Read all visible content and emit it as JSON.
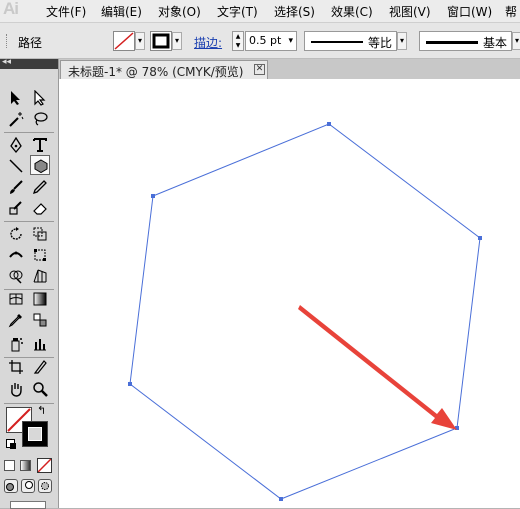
{
  "app": {
    "logo": "Ai"
  },
  "menu": [
    "文件(F)",
    "编辑(E)",
    "对象(O)",
    "文字(T)",
    "选择(S)",
    "效果(C)",
    "视图(V)",
    "窗口(W)",
    "帮"
  ],
  "control_bar": {
    "selection_type": "路径",
    "stroke_label": "描边:",
    "stroke_weight": "0.5 pt",
    "variable_width_profile": "等比",
    "brush_definition": "基本"
  },
  "document": {
    "tab_title": "未标题-1* @ 78% (CMYK/预览)",
    "tab_close": "✕"
  },
  "toolbox": {
    "collapse": "◂◂",
    "tools": [
      "selection",
      "direct-selection",
      "magic-wand",
      "lasso",
      "pen",
      "type",
      "line-segment",
      "polygon",
      "paintbrush",
      "pencil",
      "blob-brush",
      "eraser",
      "rotate",
      "scale",
      "width",
      "free-transform",
      "shape-builder",
      "perspective-grid",
      "mesh",
      "gradient",
      "eyedropper",
      "blend",
      "symbol-sprayer",
      "column-graph",
      "artboard",
      "slice",
      "hand",
      "zoom"
    ],
    "active_tool": "polygon",
    "fill": "none",
    "stroke_color": "#000000"
  },
  "colors": {
    "path_stroke": "#4a6fd8",
    "arrow": "#e8433a",
    "stroke_link": "#1a3fb0"
  },
  "canvas": {
    "shape": "hexagon",
    "annotation": "red-arrow"
  }
}
